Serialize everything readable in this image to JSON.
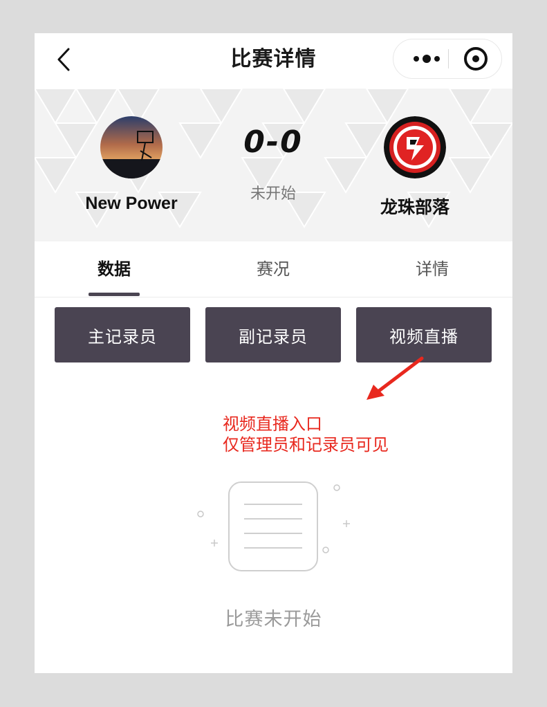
{
  "nav": {
    "title": "比赛详情"
  },
  "match": {
    "home_team": "New Power",
    "away_team": "龙珠部落",
    "score": "0-0",
    "status": "未开始"
  },
  "tabs": [
    {
      "label": "数据",
      "active": true
    },
    {
      "label": "赛况",
      "active": false
    },
    {
      "label": "详情",
      "active": false
    }
  ],
  "actions": [
    {
      "label": "主记录员"
    },
    {
      "label": "副记录员"
    },
    {
      "label": "视频直播"
    }
  ],
  "annotation": {
    "line1": "视频直播入口",
    "line2": "仅管理员和记录员可见",
    "color": "#e8281e"
  },
  "empty_state": {
    "text": "比赛未开始"
  },
  "colors": {
    "button_bg": "#4a4452",
    "tab_indicator": "#4a4451",
    "annotation_red": "#e8281e"
  },
  "icons": {
    "back": "chevron-left-icon",
    "more": "more-dots-icon",
    "close_target": "target-icon",
    "empty": "document-icon"
  }
}
